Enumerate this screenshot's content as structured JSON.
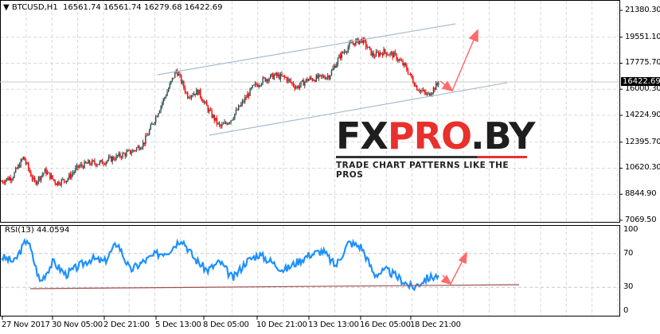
{
  "header": {
    "symbol": "BTCUSD,H1",
    "open": "16561.74",
    "high": "16561.74",
    "low": "16279.68",
    "close": "16422.69"
  },
  "rsi_label": "RSI(13) 44.0594",
  "logo": {
    "fx": "FX",
    "pro": "PRO",
    "by": ".BY",
    "tagline": "TRADE CHART PATTERNS LIKE THE PROS"
  },
  "colors": {
    "bull": "#2f4f4f",
    "bear": "#ff0000",
    "rsi": "#1e90ff",
    "trend": "#b0c4d8",
    "arrow": "#ff6a6a",
    "grid": "#d8d8d8"
  },
  "chart_data": [
    {
      "type": "candlestick",
      "title": "BTCUSD,H1",
      "ylim": [
        7069.5,
        21380.3
      ],
      "yticks": [
        "21380.30",
        "19551.10",
        "17775.70",
        "16000.30",
        "14224.90",
        "12395.70",
        "10620.30",
        "8844.90",
        "7069.50"
      ],
      "current_price": "16422.69",
      "xticks": [
        "27 Nov 2017",
        "30 Nov 05:00",
        "2 Dec 21:00",
        "5 Dec 13:00",
        "8 Dec 05:00",
        "10 Dec 21:00",
        "13 Dec 13:00",
        "16 Dec 05:00",
        "18 Dec 21:00"
      ],
      "close_path": [
        9725,
        10050,
        11351,
        9616,
        10430,
        9616,
        9887,
        10701,
        10972,
        10972,
        11243,
        11514,
        11785,
        12327,
        13953,
        15580,
        17314,
        15580,
        15851,
        14495,
        13411,
        13953,
        15037,
        16122,
        16664,
        16935,
        16772,
        16122,
        16664,
        16772,
        16935,
        18290,
        19103,
        19374,
        18290,
        18561,
        18290,
        17477,
        16122,
        15580,
        16422.69
      ]
    },
    {
      "type": "line",
      "title": "RSI(13)",
      "last_value": 44.0594,
      "ylim": [
        0,
        100
      ],
      "yticks": [
        "100",
        "70",
        "30",
        "0"
      ],
      "values": [
        66,
        60,
        88,
        36,
        60,
        45,
        55,
        64,
        60,
        83,
        50,
        60,
        69,
        73,
        88,
        64,
        50,
        60,
        40,
        60,
        69,
        60,
        50,
        60,
        69,
        73,
        55,
        83,
        78,
        45,
        50,
        40,
        29,
        40,
        44
      ]
    }
  ]
}
